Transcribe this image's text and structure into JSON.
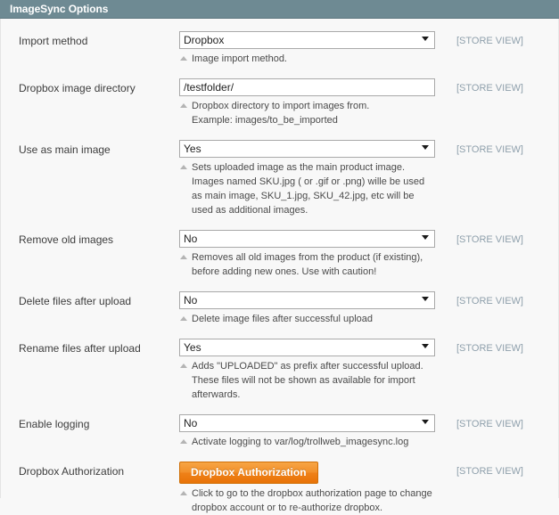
{
  "panel": {
    "title": "ImageSync Options",
    "header_bg": "#6e8a93",
    "accent_button_color": "#ef8118",
    "scope_label_color": "#8fa0ac"
  },
  "fields": [
    {
      "label": "Import method",
      "type": "select",
      "value": "Dropbox",
      "scope": "[STORE VIEW]",
      "hint": [
        "Image import method."
      ]
    },
    {
      "label": "Dropbox image directory",
      "type": "text",
      "value": "/testfolder/",
      "placeholder": "",
      "scope": "[STORE VIEW]",
      "hint": [
        "Dropbox directory to import images from.",
        "Example: images/to_be_imported"
      ]
    },
    {
      "label": "Use as main image",
      "type": "select",
      "value": "Yes",
      "scope": "[STORE VIEW]",
      "hint": [
        "Sets uploaded image as the main product image.",
        "Images named SKU.jpg ( or .gif or .png) wille be used",
        "as main image, SKU_1.jpg, SKU_42.jpg, etc will be",
        "used as additional images."
      ]
    },
    {
      "label": "Remove old images",
      "type": "select",
      "value": "No",
      "scope": "[STORE VIEW]",
      "hint": [
        "Removes all old images from the product (if existing),",
        "before adding new ones. Use with caution!"
      ]
    },
    {
      "label": "Delete files after upload",
      "type": "select",
      "value": "No",
      "scope": "[STORE VIEW]",
      "hint": [
        "Delete image files after successful upload"
      ]
    },
    {
      "label": "Rename files after upload",
      "type": "select",
      "value": "Yes",
      "scope": "[STORE VIEW]",
      "hint": [
        "Adds \"UPLOADED\" as prefix after successful upload.",
        "These files will not be shown as available for import",
        "afterwards."
      ]
    },
    {
      "label": "Enable logging",
      "type": "select",
      "value": "No",
      "scope": "[STORE VIEW]",
      "hint": [
        "Activate logging to var/log/trollweb_imagesync.log"
      ]
    },
    {
      "label": "Dropbox Authorization",
      "type": "button",
      "value": "Dropbox Authorization",
      "scope": "[STORE VIEW]",
      "hint": [
        "Click to go to the dropbox authorization page to change",
        "dropbox account or to re-authorize dropbox."
      ]
    }
  ]
}
